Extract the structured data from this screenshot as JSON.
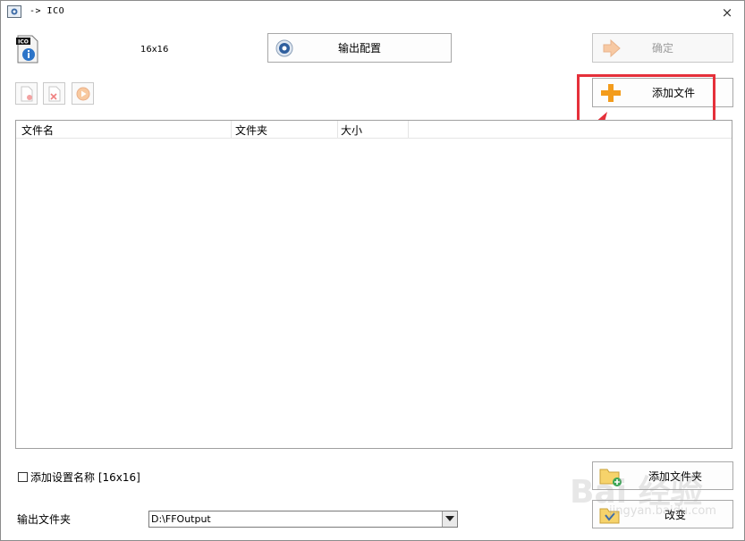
{
  "window": {
    "title": "-> ICO",
    "close_symbol": "×"
  },
  "header": {
    "size_label": "16x16",
    "config_button": "输出配置",
    "ok_button": "确定"
  },
  "actions": {
    "add_file_button": "添加文件",
    "add_folder_button": "添加文件夹",
    "change_button": "改变"
  },
  "file_list": {
    "columns": [
      "文件名",
      "文件夹",
      "大小"
    ]
  },
  "options": {
    "add_setting_name_label": "添加设置名称 [16x16]",
    "add_setting_name_checked": false
  },
  "output": {
    "label": "输出文件夹",
    "folder_value": "D:\\FFOutput"
  },
  "icons": {
    "app": "app-icon",
    "ico": "ico-file-info-icon",
    "config": "config-gear-icon",
    "ok": "ok-arrow-icon",
    "add_file": "orange-plus-icon",
    "add_folder": "folder-add-icon",
    "change": "folder-change-icon"
  },
  "watermark": {
    "main": "Bai 经验",
    "sub": "jingyan.baidu.com"
  },
  "colors": {
    "highlight": "#e5303a",
    "plus": "#f39c1c"
  }
}
